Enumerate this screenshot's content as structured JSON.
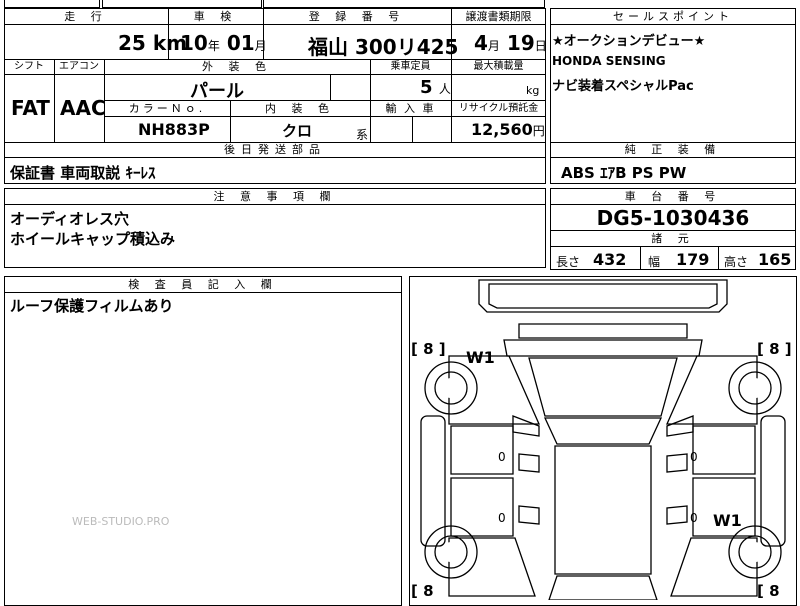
{
  "top": {
    "headers": {
      "mileage": "走 行",
      "inspection": "車 検",
      "reg_no": "登 録 番 号",
      "transfer": "譲渡書類期限"
    },
    "mileage": {
      "value": "25",
      "unit": "km"
    },
    "inspection": {
      "year": "10",
      "year_unit": "年",
      "month": "01",
      "month_unit": "月"
    },
    "reg_no": "福山 300リ425",
    "transfer": {
      "month": "4",
      "month_unit": "月",
      "day": "19",
      "day_unit": "日"
    }
  },
  "spec": {
    "shift_label": "シフト",
    "ac_label": "エアコン",
    "color_label": "外 装 色",
    "capacity_label": "乗車定員",
    "load_label": "最大積載量",
    "shift": "FAT",
    "ac": "AAC",
    "exterior": "パール",
    "capacity": "5",
    "capacity_unit": "人",
    "load": "",
    "load_unit": "kg",
    "colorno_label": "カラーＮｏ.",
    "interior_label": "内 装 色",
    "import_label": "輸 入 車",
    "recycle_label": "リサイクル預託金",
    "colorno": "NH883P",
    "interior": "クロ",
    "interior_unit": "系",
    "recycle": "12,560",
    "recycle_unit": "円"
  },
  "sales": {
    "header": "セールスポイント",
    "lines": [
      "★オークションデビュー★",
      "HONDA SENSING",
      "ナビ装着スペシャルPac"
    ]
  },
  "later": {
    "header": "後日発送部品",
    "text": "保証書 車両取説 ｷｰﾚｽ"
  },
  "equip": {
    "header": "純 正 装 備",
    "text": "ABS ｴｱB PS PW"
  },
  "notes": {
    "header": "注 意 事 項 欄",
    "lines": [
      "オーディオレス穴",
      "ホイールキャップ積込み"
    ]
  },
  "chassis": {
    "header": "車 台 番 号",
    "value": "DG5-1030436"
  },
  "dims": {
    "header": "諸 元",
    "length_label": "長さ",
    "length": "432",
    "width_label": "幅",
    "width": "179",
    "height_label": "高さ",
    "height": "165"
  },
  "inspector": {
    "header": "検 査 員 記 入 欄",
    "text": "ルーフ保護フィルムあり"
  },
  "diagram": {
    "tire_tl": "[ 8 ]",
    "tire_tr": "[ 8 ]",
    "tire_bl": "[ 8",
    "tire_br": "[ 8",
    "mark_w1_top": "W1",
    "mark_w1_bottom": "W1",
    "zero_left_top": "0",
    "zero_left_bottom": "0",
    "zero_right_top": "0",
    "zero_right_bottom": "0"
  },
  "watermark": "WEB-STUDIO.PRO"
}
